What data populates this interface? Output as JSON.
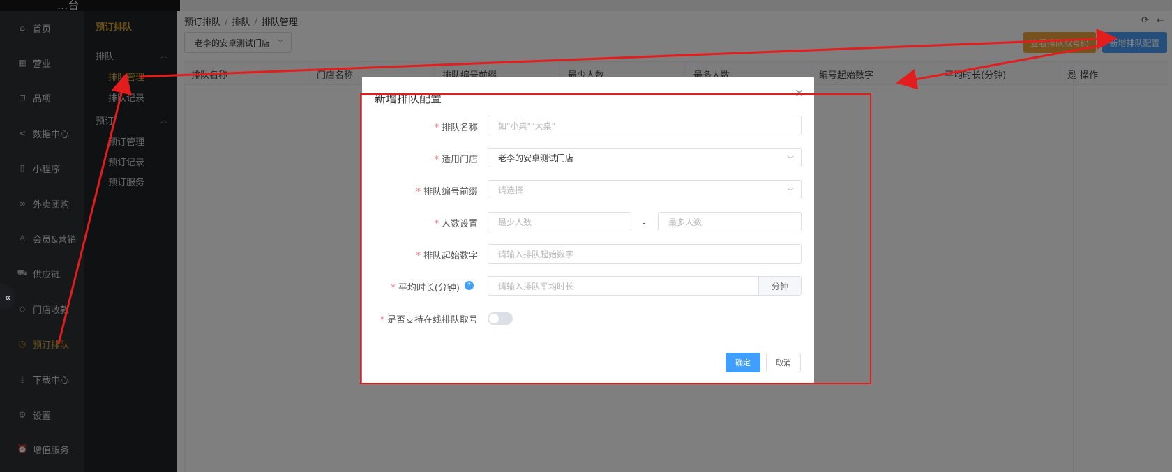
{
  "app": {
    "title": "...台"
  },
  "sidebar": {
    "items": [
      {
        "label": "首页",
        "icon": "home-icon",
        "glyph": "⌂",
        "active": false
      },
      {
        "label": "营业",
        "icon": "calendar-icon",
        "glyph": "▦",
        "active": false
      },
      {
        "label": "品项",
        "icon": "bag-icon",
        "glyph": "⊡",
        "active": false
      },
      {
        "label": "数据中心",
        "icon": "share-icon",
        "glyph": "⋖",
        "active": false
      },
      {
        "label": "小程序",
        "icon": "phone-icon",
        "glyph": "▯",
        "active": false
      },
      {
        "label": "外卖团购",
        "icon": "bike-icon",
        "glyph": "∞",
        "active": false
      },
      {
        "label": "会员&营销",
        "icon": "user-icon",
        "glyph": "♙",
        "active": false
      },
      {
        "label": "供应链",
        "icon": "truck-icon",
        "glyph": "⛟",
        "active": false
      },
      {
        "label": "门店收款",
        "icon": "shield-icon",
        "glyph": "◇",
        "active": false
      },
      {
        "label": "预订排队",
        "icon": "clock-icon",
        "glyph": "◷",
        "active": true
      },
      {
        "label": "下载中心",
        "icon": "download-icon",
        "glyph": "⤓",
        "active": false
      },
      {
        "label": "设置",
        "icon": "gear-icon",
        "glyph": "⚙",
        "active": false
      },
      {
        "label": "增值服务",
        "icon": "alarm-icon",
        "glyph": "⏰",
        "active": false
      }
    ]
  },
  "subnav": {
    "title": "预订排队",
    "group1": {
      "label": "排队",
      "items": [
        "排队管理",
        "排队记录"
      ]
    },
    "group2": {
      "label": "预订",
      "items": [
        "预订管理",
        "预订记录",
        "预订服务"
      ]
    }
  },
  "breadcrumb": [
    "预订排队",
    "排队",
    "排队管理"
  ],
  "store_filter": {
    "value": "老李的安卓测试门店"
  },
  "buttons": {
    "record": "查看排队取号码",
    "new": "新增排队配置"
  },
  "table": {
    "columns": [
      "排队名称",
      "门店名称",
      "排队编号前缀",
      "最少人数",
      "最多人数",
      "编号起始数字",
      "平均时长(分钟)",
      "是",
      "操作"
    ]
  },
  "dialog": {
    "title": "新增排队配置",
    "fields": {
      "name": {
        "label": "排队名称",
        "placeholder": "如\"小桌\"\"大桌\""
      },
      "store": {
        "label": "适用门店",
        "value": "老李的安卓测试门店"
      },
      "prefix": {
        "label": "排队编号前缀",
        "placeholder": "请选择"
      },
      "people": {
        "label": "人数设置",
        "min_placeholder": "最少人数",
        "max_placeholder": "最多人数",
        "dash": "-"
      },
      "start": {
        "label": "排队起始数字",
        "placeholder": "请输入排队起始数字"
      },
      "duration": {
        "label": "平均时长(分钟)",
        "placeholder": "请输入排队平均时长",
        "suffix": "分钟"
      },
      "online": {
        "label": "是否支持在线排队取号",
        "enabled": false
      }
    },
    "required_mark": "*",
    "ok": "确定",
    "cancel": "取消"
  },
  "colors": {
    "accent": "#d6a532",
    "primary": "#409eff",
    "annotation": "#e21d1d"
  }
}
